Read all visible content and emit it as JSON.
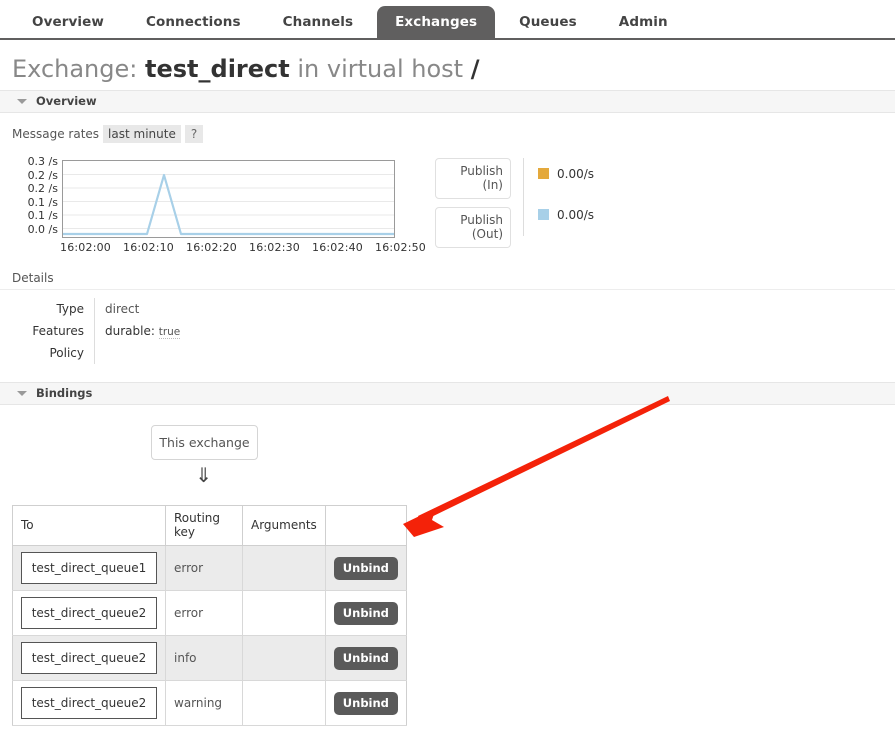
{
  "nav": {
    "tabs": [
      {
        "label": "Overview",
        "active": false
      },
      {
        "label": "Connections",
        "active": false
      },
      {
        "label": "Channels",
        "active": false
      },
      {
        "label": "Exchanges",
        "active": true
      },
      {
        "label": "Queues",
        "active": false
      },
      {
        "label": "Admin",
        "active": false
      }
    ]
  },
  "page": {
    "title_prefix": "Exchange:",
    "title_name": "test_direct",
    "title_middle": "in virtual host",
    "title_vhost": "/"
  },
  "overview": {
    "section_label": "Overview",
    "rates_label": "Message rates",
    "rates_period": "last minute",
    "help": "?"
  },
  "chart_data": {
    "type": "line",
    "title": "Message rates",
    "xlabel": "",
    "ylabel": "/s",
    "ylim": [
      0.0,
      0.3
    ],
    "grid": true,
    "legend_position": "right",
    "y_ticks": [
      "0.3 /s",
      "0.2 /s",
      "0.2 /s",
      "0.1 /s",
      "0.1 /s",
      "0.0 /s"
    ],
    "y_tick_values": [
      0.3,
      0.25,
      0.2,
      0.15,
      0.1,
      0.0
    ],
    "x_ticks": [
      "16:02:00",
      "16:02:10",
      "16:02:20",
      "16:02:30",
      "16:02:40",
      "16:02:50"
    ],
    "series": [
      {
        "name": "Publish (In)",
        "color": "#e4a93c",
        "current_value": "0.00/s",
        "values": [
          0,
          0,
          0,
          0,
          0,
          0,
          0,
          0,
          0,
          0,
          0,
          0
        ]
      },
      {
        "name": "Publish (Out)",
        "color": "#a8d0e8",
        "current_value": "0.00/s",
        "values": [
          0,
          0,
          0,
          0,
          0.25,
          0,
          0,
          0,
          0,
          0,
          0,
          0
        ]
      }
    ]
  },
  "legend": {
    "buttons": [
      {
        "line1": "Publish",
        "line2": "(In)"
      },
      {
        "line1": "Publish",
        "line2": "(Out)"
      }
    ],
    "values": [
      {
        "color": "#e4a93c",
        "text": "0.00/s"
      },
      {
        "color": "#a8d0e8",
        "text": "0.00/s"
      }
    ]
  },
  "details": {
    "heading": "Details",
    "rows": [
      {
        "label": "Type",
        "value": "direct"
      },
      {
        "label": "Features",
        "feature_key": "durable:",
        "feature_value": "true"
      },
      {
        "label": "Policy",
        "value": ""
      }
    ]
  },
  "bindings": {
    "section_label": "Bindings",
    "this_exchange": "This exchange",
    "arrow_glyph": "⇓",
    "columns": [
      "To",
      "Routing key",
      "Arguments",
      ""
    ],
    "rows": [
      {
        "to": "test_direct_queue1",
        "routing_key": "error",
        "arguments": "",
        "action": "Unbind"
      },
      {
        "to": "test_direct_queue2",
        "routing_key": "error",
        "arguments": "",
        "action": "Unbind"
      },
      {
        "to": "test_direct_queue2",
        "routing_key": "info",
        "arguments": "",
        "action": "Unbind"
      },
      {
        "to": "test_direct_queue2",
        "routing_key": "warning",
        "arguments": "",
        "action": "Unbind"
      }
    ]
  },
  "annotation": {
    "color": "#f42209"
  }
}
